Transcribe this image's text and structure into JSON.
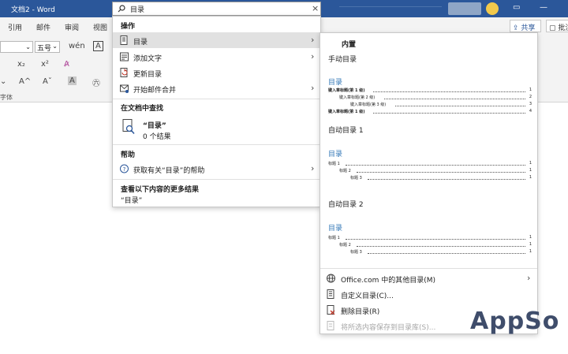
{
  "titlebar": {
    "doc_title": "文档2  -  Word",
    "bg": "#2b579a"
  },
  "tabs": [
    "引用",
    "邮件",
    "审阅",
    "视图"
  ],
  "share_label": "共享",
  "comment_label": "批注",
  "ribbon": {
    "font_size": "五号",
    "group_label": "字体"
  },
  "search": {
    "value": "目录",
    "clear_icon": "close-icon"
  },
  "panel": {
    "actions_header": "操作",
    "actions": [
      {
        "label": "目录",
        "icon": "toc-icon",
        "chevron": true,
        "selected": true
      },
      {
        "label": "添加文字",
        "icon": "add-text-icon",
        "chevron": true
      },
      {
        "label": "更新目录",
        "icon": "update-toc-icon",
        "chevron": false
      },
      {
        "label": "开始邮件合并",
        "icon": "mail-merge-icon",
        "chevron": true
      }
    ],
    "find_header": "在文档中查找",
    "find_term": "“目录”",
    "find_count": "0 个结果",
    "help_header": "帮助",
    "help_item": "获取有关“目录”的帮助",
    "more_header": "查看以下内容的更多结果",
    "more_term": "“目录”"
  },
  "gallery": {
    "header": "内置",
    "manual_label": "手动目录",
    "auto1_label": "自动目录 1",
    "auto2_label": "自动目录 2",
    "toc_title": "目录",
    "manual_lines": [
      {
        "text": "键入章标题(第 1 级)",
        "page": "1",
        "indent": 0,
        "bold": true
      },
      {
        "text": "键入章标题(第 2 级)",
        "page": "2",
        "indent": 1,
        "bold": false
      },
      {
        "text": "键入章标题(第 3 级)",
        "page": "3",
        "indent": 2,
        "bold": false
      },
      {
        "text": "键入章标题(第 1 级)",
        "page": "4",
        "indent": 0,
        "bold": true
      }
    ],
    "auto_lines": [
      {
        "text": "标题 1",
        "page": "1",
        "indent": 0
      },
      {
        "text": "标题 2",
        "page": "1",
        "indent": 1
      },
      {
        "text": "标题 3",
        "page": "1",
        "indent": 2
      }
    ],
    "footer": [
      {
        "label": "Office.com 中的其他目录(M)",
        "icon": "globe-icon",
        "chevron": true,
        "disabled": false
      },
      {
        "label": "自定义目录(C)...",
        "icon": "custom-toc-icon",
        "chevron": false,
        "disabled": false
      },
      {
        "label": "删除目录(R)",
        "icon": "remove-toc-icon",
        "chevron": false,
        "disabled": false
      },
      {
        "label": "将所选内容保存到目录库(S)...",
        "icon": "save-selection-icon",
        "chevron": false,
        "disabled": true
      }
    ]
  },
  "watermark": "AppSo"
}
